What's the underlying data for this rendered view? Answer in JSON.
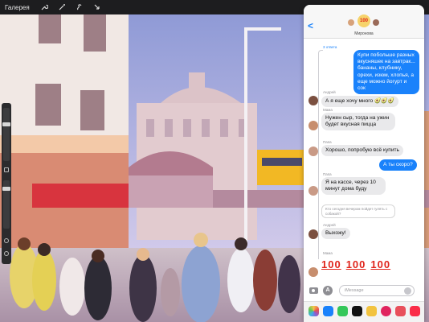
{
  "topbar": {
    "gallery_label": "Галерея",
    "tools": [
      "wrench-icon",
      "magic-wand-icon",
      "selection-icon",
      "transform-arrow-icon"
    ]
  },
  "messages": {
    "group_name": "Миронова",
    "back_label": "<",
    "reply_count": "3 ответа",
    "bubbles": [
      {
        "sender": "",
        "text": "Купи побольше разных вкусняшек на завтрак... бананы, клубнику, орехи, изюм, хлопья, а еще можно йогурт и сок",
        "direction": "out"
      },
      {
        "sender": "Андрей",
        "text": "А я еще хочу много 🥑🥑🥑",
        "direction": "in"
      },
      {
        "sender": "Мама",
        "text": "Нужен сыр, тогда на ужин будет вкусная пицца",
        "direction": "in"
      },
      {
        "sender": "Папа",
        "text": "Хорошо, попробую всё купить",
        "direction": "in"
      },
      {
        "sender": "",
        "text": "А ты скоро?",
        "direction": "out"
      },
      {
        "sender": "Папа",
        "text": "Я на кассе, через 10 минут дома буду",
        "direction": "in"
      },
      {
        "sender": "",
        "text": "Кто сегодня вечером пойдет гулять с собакой?",
        "direction": "quote"
      },
      {
        "sender": "Андрей",
        "text": "Выхожу!",
        "direction": "in"
      }
    ],
    "final_sender": "Мама",
    "final_emoji": [
      "100",
      "100",
      "100"
    ],
    "compose_placeholder": "iMessage"
  },
  "colors": {
    "imessage_blue": "#1a82fb",
    "incoming_gray": "#e9e9eb",
    "emoji_red": "#e0241b"
  }
}
